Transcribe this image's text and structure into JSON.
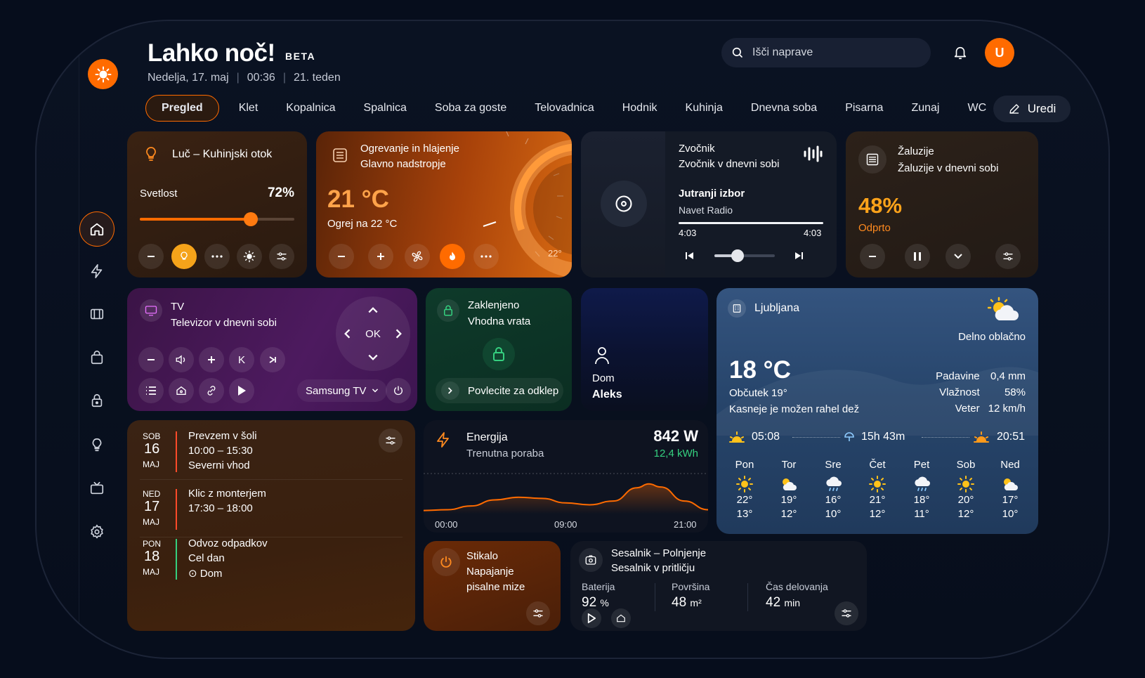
{
  "header": {
    "greeting": "Lahko noč!",
    "badge": "BETA",
    "date": "Nedelja, 17. maj",
    "time": "00:36",
    "week": "21. teden",
    "search_placeholder": "Išči naprave",
    "avatar_initial": "U",
    "edit_label": "Uredi"
  },
  "tabs": [
    "Pregled",
    "Klet",
    "Kopalnica",
    "Spalnica",
    "Soba za goste",
    "Telovadnica",
    "Hodnik",
    "Kuhinja",
    "Dnevna soba",
    "Pisarna",
    "Zunaj",
    "WC"
  ],
  "colors": {
    "accent": "#ff6b00",
    "green": "#35d07f",
    "bg": "#060d1c"
  },
  "light": {
    "title": "Luč – Kuhinjski otok",
    "label": "Svetlost",
    "value": "72%",
    "brightness_fraction": 0.72
  },
  "heating": {
    "title": "Ogrevanje in hlajenje",
    "zone": "Glavno nadstropje",
    "temp": "21 °C",
    "target": "Ogrej na 22 °C",
    "dial_label": "22°"
  },
  "speaker": {
    "title": "Zvočnik",
    "subtitle": "Zvočnik v dnevni sobi",
    "track": "Jutranji izbor",
    "artist": "Navet Radio",
    "elapsed": "4:03",
    "duration": "4:03",
    "volume_fraction": 0.38
  },
  "blinds": {
    "title": "Žaluzije",
    "subtitle": "Žaluzije v dnevni sobi",
    "percent": "48%",
    "status": "Odprto"
  },
  "tv": {
    "title": "TV",
    "subtitle": "Televizor v dnevni sobi",
    "ok": "OK",
    "channel_label": "K",
    "source": "Samsung TV"
  },
  "lock": {
    "title": "Zaklenjeno",
    "subtitle": "Vhodna vrata",
    "slide": "Povlecite za odklep"
  },
  "person": {
    "location": "Dom",
    "name": "Aleks"
  },
  "weather": {
    "city": "Ljubljana",
    "condition": "Delno oblačno",
    "temp": "18 °C",
    "feels": "Občutek 19°",
    "forecast": "Kasneje je možen rahel dež",
    "details": [
      {
        "label": "Padavine",
        "value": "0,4 mm"
      },
      {
        "label": "Vlažnost",
        "value": "58%"
      },
      {
        "label": "Veter",
        "value": "12 km/h"
      }
    ],
    "sunrise": "05:08",
    "daylength": "15h 43m",
    "sunset": "20:51",
    "days": [
      {
        "day": "Pon",
        "high": "22°",
        "low": "13°",
        "icon": "sun-icon"
      },
      {
        "day": "Tor",
        "high": "19°",
        "low": "12°",
        "icon": "partly-cloudy-icon"
      },
      {
        "day": "Sre",
        "high": "16°",
        "low": "10°",
        "icon": "rain-icon"
      },
      {
        "day": "Čet",
        "high": "21°",
        "low": "12°",
        "icon": "sun-icon"
      },
      {
        "day": "Pet",
        "high": "18°",
        "low": "11°",
        "icon": "rain-icon"
      },
      {
        "day": "Sob",
        "high": "20°",
        "low": "12°",
        "icon": "sun-icon"
      },
      {
        "day": "Ned",
        "high": "17°",
        "low": "10°",
        "icon": "partly-cloudy-icon"
      }
    ]
  },
  "calendar": [
    {
      "dow": "SOB",
      "day": "16",
      "month": "MAJ",
      "title": "Prevzem v šoli",
      "line2": "10:00 – 15:30",
      "line3": "Severni vhod"
    },
    {
      "dow": "NED",
      "day": "17",
      "month": "MAJ",
      "title": "Klic z monterjem",
      "line2": "17:30 – 18:00",
      "line3": ""
    },
    {
      "dow": "PON",
      "day": "18",
      "month": "MAJ",
      "title": "Odvoz odpadkov",
      "line2": "Cel dan",
      "line3": "⊙ Dom"
    }
  ],
  "energy": {
    "title": "Energija",
    "subtitle": "Trenutna poraba",
    "power": "842 W",
    "energy": "12,4 kWh",
    "chart_data": {
      "type": "area",
      "x_ticks": [
        "00:00",
        "09:00",
        "21:00"
      ],
      "x": [
        0,
        2,
        4,
        6,
        8,
        10,
        12,
        14,
        16,
        18,
        19,
        20,
        22,
        24
      ],
      "values": [
        0.1,
        0.12,
        0.22,
        0.38,
        0.45,
        0.42,
        0.3,
        0.25,
        0.35,
        0.7,
        0.8,
        0.72,
        0.35,
        0.12
      ]
    }
  },
  "switch": {
    "title": "Stikalo",
    "line1": "Napajanje",
    "line2": "pisalne mize"
  },
  "vacuum": {
    "title": "Sesalnik – Polnjenje",
    "subtitle": "Sesalnik v pritličju",
    "stats": [
      {
        "label": "Baterija",
        "value": "92",
        "unit": "%"
      },
      {
        "label": "Površina",
        "value": "48",
        "unit": "m²"
      },
      {
        "label": "Čas delovanja",
        "value": "42",
        "unit": "min"
      }
    ]
  }
}
